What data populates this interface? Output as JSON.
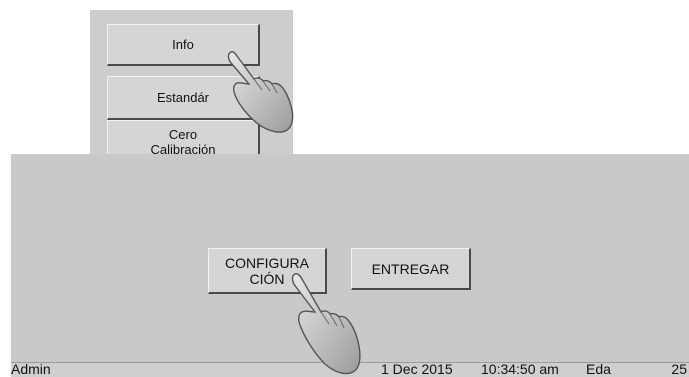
{
  "menu": {
    "items": [
      {
        "label": "Info"
      },
      {
        "label": "Estandár"
      },
      {
        "label": "Cero\nCalibración"
      }
    ]
  },
  "main": {
    "config_label": "CONFIGURA\nCIÓN",
    "deliver_label": "ENTREGAR"
  },
  "status": {
    "user": "Admin",
    "date": "1 Dec 2015",
    "time": "10:34:50 am",
    "mode": "Eda",
    "number": "25"
  },
  "colors": {
    "panel": "#c9c9c9",
    "button": "#d5d5d5"
  },
  "icons": {
    "pointer": "pointing-hand-icon"
  }
}
